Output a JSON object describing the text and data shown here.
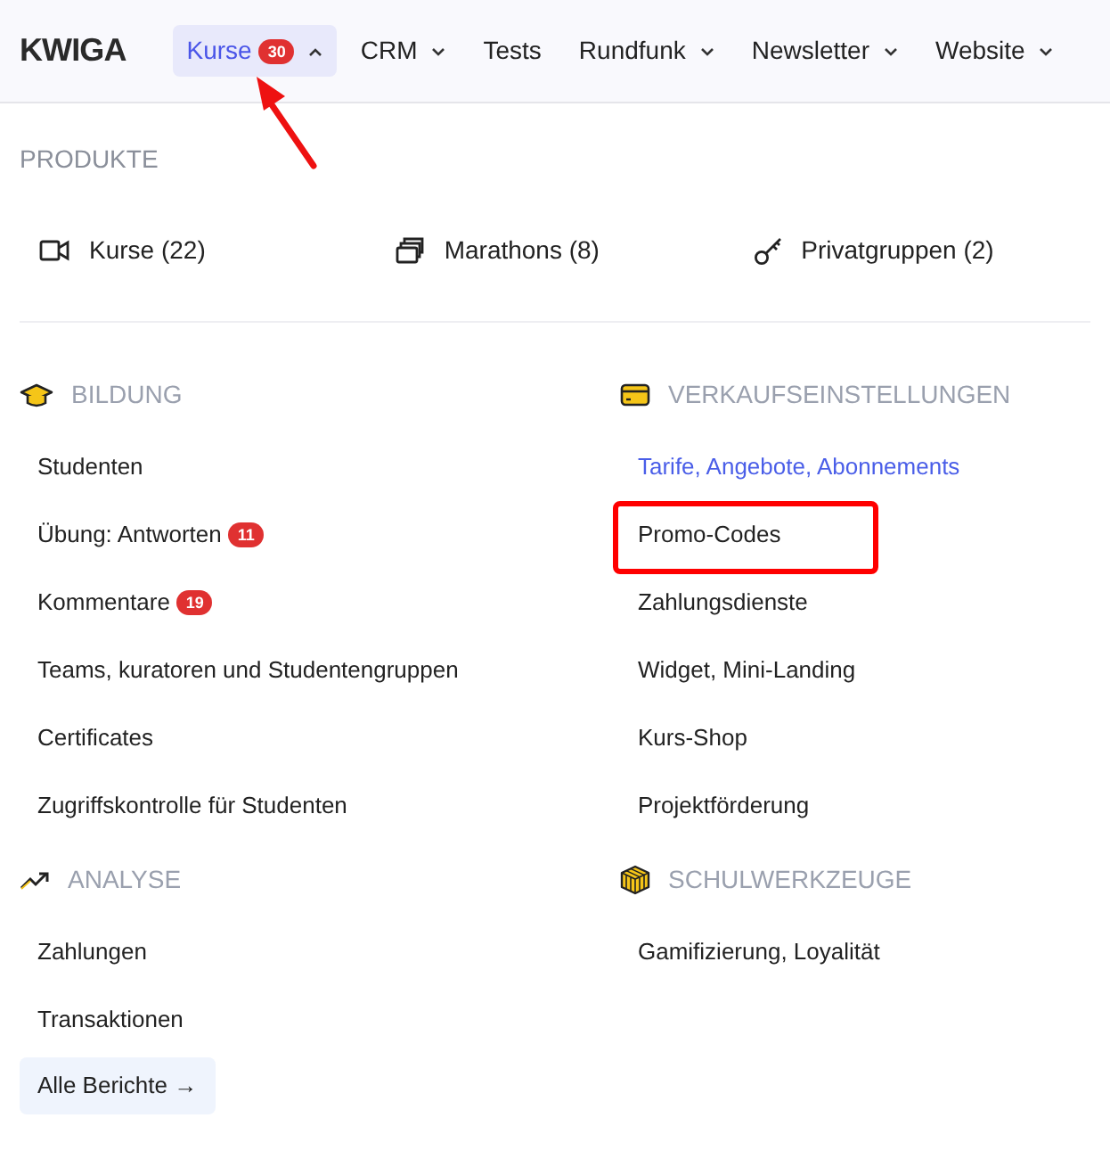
{
  "header": {
    "logo": "KWIGA",
    "nav": [
      {
        "label": "Kurse",
        "badge": "30",
        "kind": "menu",
        "expanded": true,
        "selected": true,
        "annotated": true
      },
      {
        "label": "CRM",
        "kind": "menu",
        "expanded": false,
        "selected": false,
        "annotated": false
      },
      {
        "label": "Tests",
        "kind": "link",
        "selected": false,
        "annotated": false
      },
      {
        "label": "Rundfunk",
        "kind": "menu",
        "expanded": false,
        "selected": false,
        "annotated": false
      },
      {
        "label": "Newsletter",
        "kind": "menu",
        "expanded": false,
        "selected": false,
        "annotated": false
      },
      {
        "label": "Website",
        "kind": "menu",
        "expanded": false,
        "selected": false,
        "annotated": false
      }
    ]
  },
  "products": {
    "heading": "PRODUKTE",
    "items": [
      {
        "label": "Kurse (22)",
        "kind": "video"
      },
      {
        "label": "Marathons (8)",
        "kind": "stack"
      },
      {
        "label": "Privatgruppen (2)",
        "kind": "key"
      }
    ]
  },
  "sections": [
    {
      "title": "BILDUNG",
      "kind": "cap",
      "items": [
        {
          "label": "Studenten",
          "selected": false,
          "annotated": false
        },
        {
          "label": "Übung: Antworten",
          "badge": "11",
          "selected": false,
          "annotated": false
        },
        {
          "label": "Kommentare",
          "badge": "19",
          "selected": false,
          "annotated": false
        },
        {
          "label": "Teams, kuratoren und Studentengruppen",
          "selected": false,
          "annotated": false
        },
        {
          "label": "Certificates",
          "selected": false,
          "annotated": false
        },
        {
          "label": "Zugriffskontrolle für Studenten",
          "selected": false,
          "annotated": false
        }
      ]
    },
    {
      "title": "VERKAUFSEINSTELLUNGEN",
      "kind": "card",
      "items": [
        {
          "label": "Tarife, Angebote, Abonnements",
          "selected": true,
          "annotated": false
        },
        {
          "label": "Promo-Codes",
          "selected": false,
          "annotated": true
        },
        {
          "label": "Zahlungsdienste",
          "selected": false,
          "annotated": false
        },
        {
          "label": "Widget, Mini-Landing",
          "selected": false,
          "annotated": false
        },
        {
          "label": "Kurs-Shop",
          "selected": false,
          "annotated": false
        },
        {
          "label": "Projektförderung",
          "selected": false,
          "annotated": false
        }
      ]
    },
    {
      "title": "ANALYSE",
      "kind": "trend",
      "items": [
        {
          "label": "Zahlungen",
          "selected": false,
          "annotated": false
        },
        {
          "label": "Transaktionen",
          "selected": false,
          "annotated": false
        }
      ],
      "button": "Alle Berichte →"
    },
    {
      "title": "SCHULWERKZEUGE",
      "kind": "cube",
      "items": [
        {
          "label": "Gamifizierung, Loyalität",
          "selected": false,
          "annotated": false
        }
      ]
    }
  ]
}
